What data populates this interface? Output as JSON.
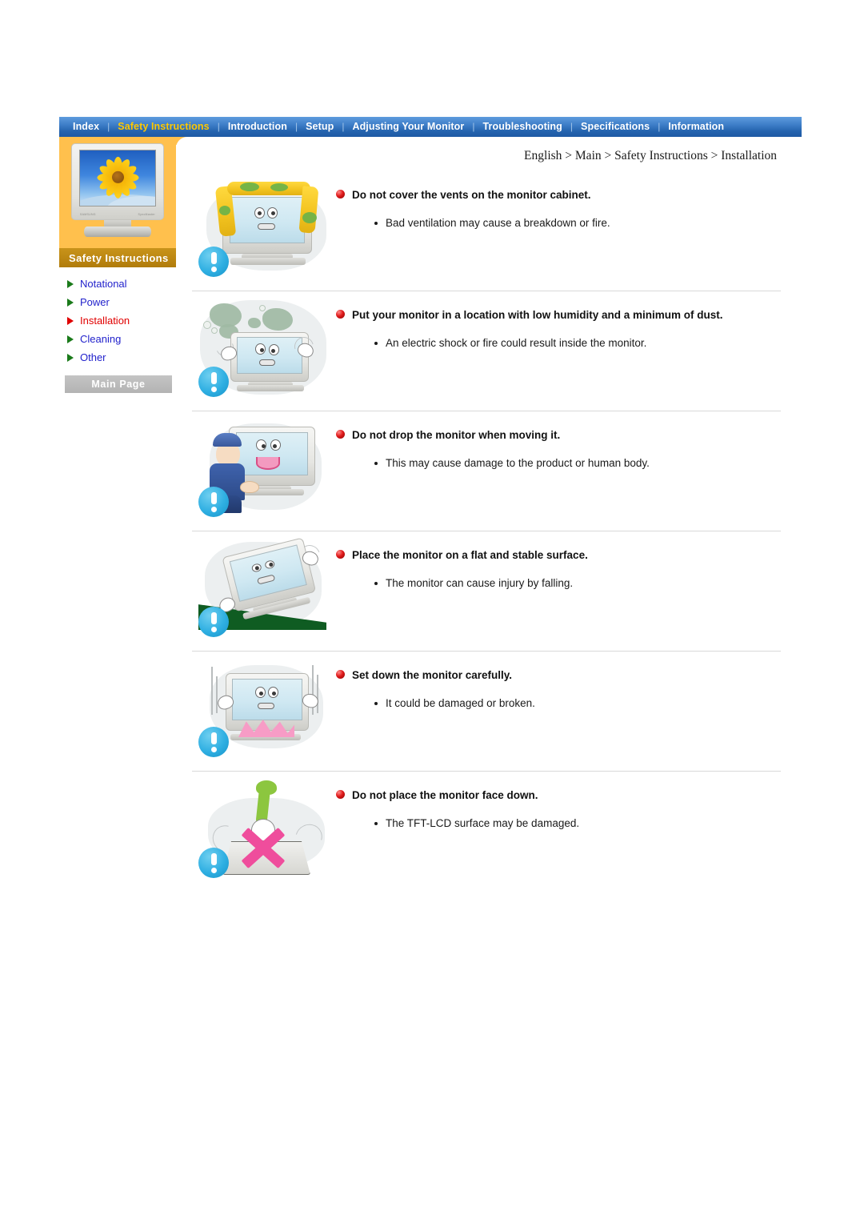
{
  "nav": {
    "items": [
      {
        "label": "Index",
        "active": false
      },
      {
        "label": "Safety Instructions",
        "active": true
      },
      {
        "label": "Introduction",
        "active": false
      },
      {
        "label": "Setup",
        "active": false
      },
      {
        "label": "Adjusting Your Monitor",
        "active": false
      },
      {
        "label": "Troubleshooting",
        "active": false
      },
      {
        "label": "Specifications",
        "active": false
      },
      {
        "label": "Information",
        "active": false
      }
    ],
    "separator": "|"
  },
  "sidebar": {
    "title": "Safety Instructions",
    "monitor_image": "crt-monitor-sunflower-wallpaper",
    "items": [
      {
        "label": "Notational",
        "active": false
      },
      {
        "label": "Power",
        "active": false
      },
      {
        "label": "Installation",
        "active": true
      },
      {
        "label": "Cleaning",
        "active": false
      },
      {
        "label": "Other",
        "active": false
      }
    ],
    "main_page_button": "Main Page"
  },
  "breadcrumb": "English > Main > Safety Instructions > Installation",
  "colors": {
    "nav_blue": "#2463ae",
    "nav_active_text": "#ffc800",
    "band_orange": "#ffc04d",
    "sidebar_title_gold": "#c08a14",
    "link_blue": "#2222cc",
    "link_active_red": "#e00000",
    "arrow_green": "#1a7a1a",
    "bullet_red": "#e01b1b",
    "warn_badge_blue": "#2fafe2",
    "main_page_gray": "#b3b3b3"
  },
  "sections": [
    {
      "heading": "Do not cover the vents on the monitor cabinet.",
      "body": "Bad ventilation may cause a breakdown or fire.",
      "illustration": "monitor-covered-with-cloth"
    },
    {
      "heading": "Put your monitor in a location with low humidity and a minimum of dust.",
      "body": "An electric shock or fire could result inside the monitor.",
      "illustration": "monitor-surrounded-by-dust-clouds"
    },
    {
      "heading": "Do not drop the monitor when moving it.",
      "body": "This may cause damage to the product or human body.",
      "illustration": "person-carrying-monitor"
    },
    {
      "heading": "Place the monitor on a flat and stable surface.",
      "body": "The monitor can cause injury by falling.",
      "illustration": "monitor-tilting-on-slope"
    },
    {
      "heading": "Set down the monitor carefully.",
      "body": "It could be damaged or broken.",
      "illustration": "monitor-dropped-with-impact"
    },
    {
      "heading": "Do not place the monitor face down.",
      "body": "The TFT-LCD surface may be damaged.",
      "illustration": "monitor-face-down-with-x-mark"
    }
  ]
}
